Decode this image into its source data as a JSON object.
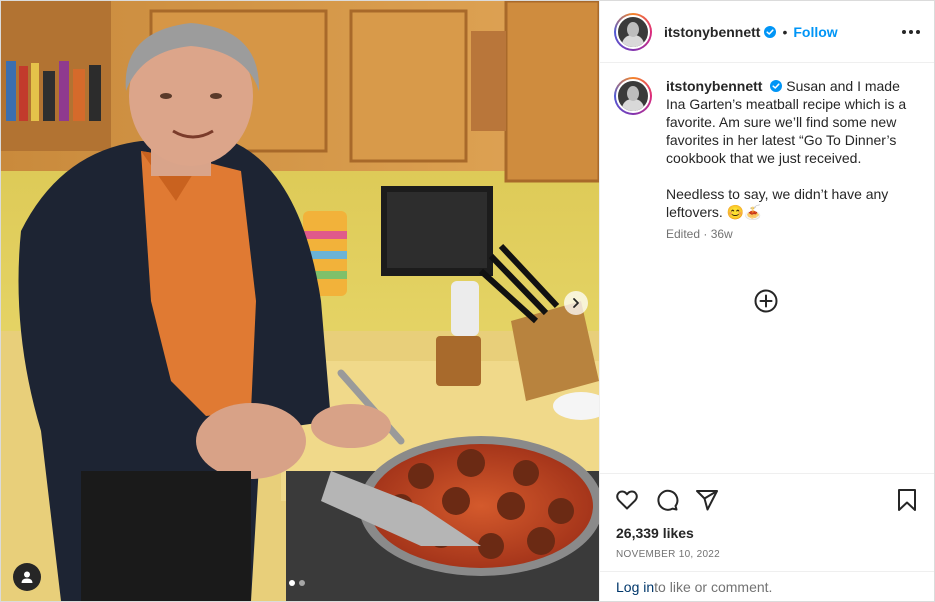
{
  "post": {
    "username": "itstonybennett",
    "follow_label": "Follow",
    "separator": "•",
    "caption_p1": "Susan and I made Ina Garten’s meatball recipe which is a favorite. Am sure we’ll find some new favorites in her latest “Go To Dinner’s cookbook that we just received.",
    "caption_p2": "Needless to say, we didn’t have any leftovers. 😊🍝",
    "meta": "Edited · 36w",
    "likes": "26,339 likes",
    "date": "NOVEMBER 10, 2022",
    "login_link": "Log in",
    "login_suffix": " to like or comment."
  },
  "media": {
    "carousel_total": 2,
    "carousel_index": 1
  },
  "icons": [
    "verified-badge",
    "more-options-icon",
    "add-comment-icon",
    "heart-icon",
    "comment-icon",
    "share-icon",
    "save-icon",
    "chevron-right-icon",
    "user-tag-icon"
  ],
  "colors": {
    "accent": "#0095f6",
    "text": "#262626",
    "muted": "#737373",
    "link": "#00376b",
    "border": "#dbdbdb"
  }
}
